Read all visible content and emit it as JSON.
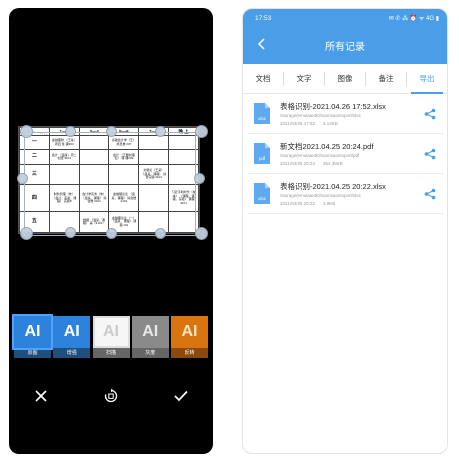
{
  "left": {
    "table": {
      "header": [
        "",
        "1—2",
        "3—4",
        "5—6",
        "7—8",
        "晚 上"
      ],
      "rows": [
        {
          "label": "一",
          "cells": [
            "金融理财\n（王某）周四\n鉴·课303",
            "",
            "基础会计学（王）\n成员楼 207",
            "",
            ""
          ]
        },
        {
          "label": "二",
          "cells": [
            "会计\n（温某）周二\n创建 3101",
            "",
            "会计\n（王雅创理论）\n课·课209",
            "",
            ""
          ]
        },
        {
          "label": "三",
          "cells": [
            "",
            "",
            "",
            "文献论（王某）\n（温某，课程）\n综合实验 3101",
            ""
          ]
        },
        {
          "label": "四",
          "cells": [
            "财务管理（朱）\n（会计，实验，课程）\n实验8",
            "会计学实务（朱）\n（温某，课程）\n综合楼 3101",
            "金融理论论\n（温某，课程）\n综合楼 3101",
            "",
            "习近平新时代（校本）\n（课程，课程，实验）\n课程 3101"
          ]
        },
        {
          "label": "五",
          "cells": [
            "",
            "数据\n（温某，课程）\n第（3101）",
            "金融理论论（一）\n（温某，课程）\n课程 101",
            "",
            ""
          ]
        }
      ]
    },
    "filters": [
      {
        "icon_text": "AI",
        "label": "原图"
      },
      {
        "icon_text": "AI",
        "label": "增强"
      },
      {
        "icon_text": "AI",
        "label": "扫描"
      },
      {
        "icon_text": "AI",
        "label": "灰度"
      },
      {
        "icon_text": "AI",
        "label": "反转"
      }
    ],
    "actions": {
      "cancel_icon": "close-icon",
      "rotate_icon": "rotate-icon",
      "confirm_icon": "check-icon"
    }
  },
  "right": {
    "status": {
      "time": "17:53",
      "icons": "✉ ✆ ⁂ ⏰ ᯤ 4G ▮"
    },
    "title": "所有记录",
    "tabs": [
      {
        "label": "文档"
      },
      {
        "label": "文字"
      },
      {
        "label": "图像"
      },
      {
        "label": "备注"
      },
      {
        "label": "导出"
      }
    ],
    "active_tab": "导出",
    "files": [
      {
        "type": "xlsx",
        "name": "表格识别-2021.04.26 17:52.xlsx",
        "path": "/storage/emulated/0/saomiao/export/xlsx",
        "date": "2021/04/26 17:52",
        "size": "4.14KB"
      },
      {
        "type": "pdf",
        "name": "新文档2021.04.25 20:24.pdf",
        "path": "/storage/emulated/0/saomiao/export/pdf",
        "date": "2021/04/25 20:24",
        "size": "364.38KB"
      },
      {
        "type": "xlsx",
        "name": "表格识别-2021.04.25 20:22.xlsx",
        "path": "/storage/emulated/0/saomiao/export/xlsx",
        "date": "2021/04/25 20:22",
        "size": "3.9KB"
      }
    ],
    "accent_color": "#4a9ee8"
  }
}
